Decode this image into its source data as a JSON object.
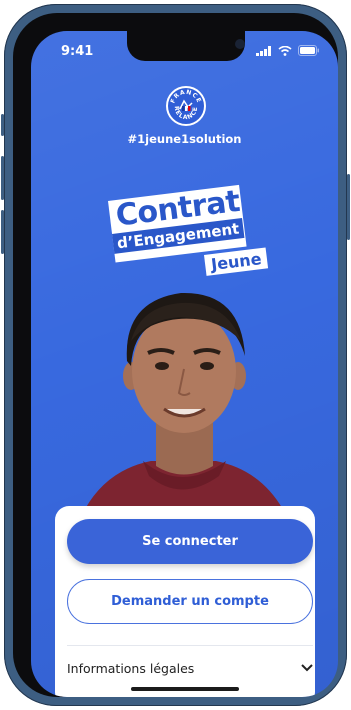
{
  "status_bar": {
    "time": "9:41"
  },
  "header": {
    "logo_text": "FRANCE RELANCE",
    "hashtag": "#1jeune1solution"
  },
  "brand": {
    "line1": "Contrat",
    "line2": "d’Engagement",
    "line3": "Jeune"
  },
  "actions": {
    "login_label": "Se connecter",
    "request_account_label": "Demander un compte"
  },
  "footer": {
    "legal_label": "Informations légales"
  },
  "colors": {
    "background": "#3869df",
    "primary": "#3a64d8",
    "card": "#ffffff"
  }
}
